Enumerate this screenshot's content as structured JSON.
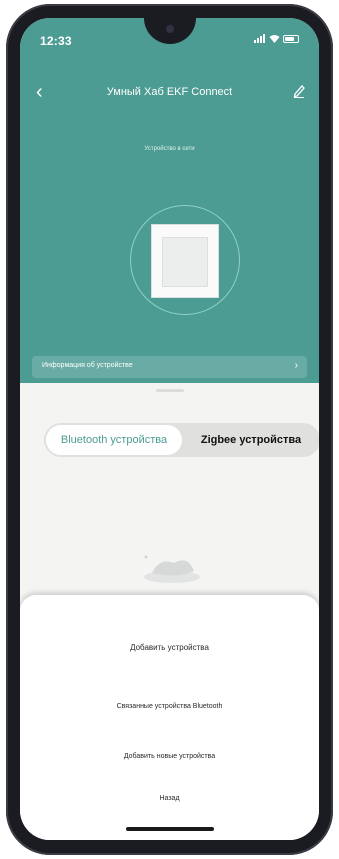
{
  "status_bar": {
    "time": "12:33",
    "signal_icon": "signal-icon",
    "wifi_icon": "wifi-icon",
    "battery_icon": "battery-icon"
  },
  "header": {
    "title": "Умный Хаб EKF Connect",
    "subtitle": "Устройство в сети",
    "back_icon": "chevron-left-icon",
    "edit_icon": "pencil-icon",
    "background_color": "#4d9c94",
    "info_bar": {
      "label": "Информация об устройстве",
      "chevron": "›"
    }
  },
  "tabs": [
    {
      "label": "Bluetooth устройства",
      "active": true
    },
    {
      "label": "Zigbee устройства",
      "active": false
    }
  ],
  "bottom_sheet": {
    "items": [
      {
        "label": "Добавить устройства"
      },
      {
        "label": "Связанные устройства Bluetooth"
      },
      {
        "label": "Добавить новые устройства"
      },
      {
        "label": "Назад"
      }
    ]
  },
  "colors": {
    "accent": "#4d9c94",
    "active_tab_text": "#4d9c94",
    "sheet_background": "#ffffff"
  }
}
